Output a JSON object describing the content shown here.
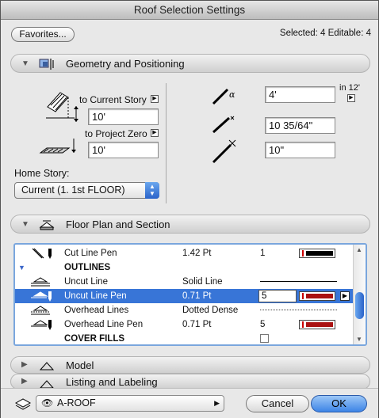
{
  "window": {
    "title": "Roof Selection Settings"
  },
  "header": {
    "favorites_label": "Favorites...",
    "selection_info": "Selected: 4 Editable: 4"
  },
  "sections": {
    "geometry": "Geometry and Positioning",
    "floor_plan": "Floor Plan and Section",
    "model": "Model",
    "listing": "Listing and Labeling"
  },
  "geometry": {
    "to_current_story_label": "to Current Story",
    "to_current_story_value": "10'",
    "to_project_zero_label": "to Project Zero",
    "to_project_zero_value": "10'",
    "home_story_label": "Home Story:",
    "home_story_value": "Current (1. 1st FLOOR)",
    "pitch_unit": "in 12'",
    "pitch_value": "4'",
    "thickness_value": "10 35/64\"",
    "offset_value": "10\""
  },
  "list_rows": [
    {
      "name": "Cut Line Pen",
      "value": "1.42 Pt",
      "number": "1",
      "icon": "pen-icon",
      "swatch": "black"
    },
    {
      "name": "OUTLINES",
      "group": true
    },
    {
      "name": "Uncut Line",
      "value": "Solid Line",
      "icon": "line-type-icon",
      "line": "solid"
    },
    {
      "name": "Uncut Line Pen",
      "value": "0.71 Pt",
      "number": "5",
      "icon": "pen-icon",
      "swatch": "red",
      "selected": true
    },
    {
      "name": "Overhead Lines",
      "value": "Dotted Dense",
      "icon": "line-type-icon",
      "line": "dotted"
    },
    {
      "name": "Overhead Line Pen",
      "value": "0.71 Pt",
      "number": "5",
      "icon": "pen-icon",
      "swatch": "red"
    },
    {
      "name": "COVER FILLS",
      "group": true,
      "checkbox": true
    }
  ],
  "footer": {
    "layer_value": "A-ROOF",
    "cancel_label": "Cancel",
    "ok_label": "OK"
  },
  "colors": {
    "accent_blue": "#3875d7",
    "ok_button": "#3d84e6",
    "pen_red": "#aa1111"
  }
}
